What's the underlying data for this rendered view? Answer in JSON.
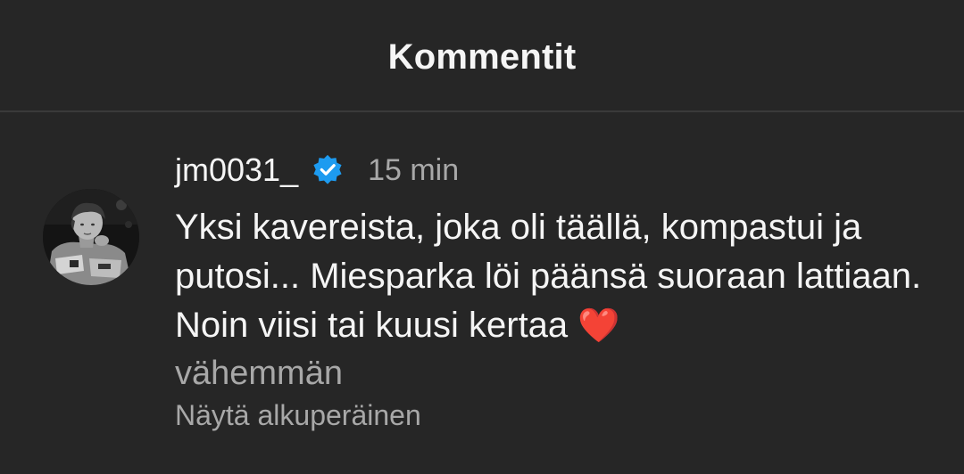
{
  "header": {
    "title": "Kommentit"
  },
  "comment": {
    "username": "jm0031_",
    "verified": true,
    "timestamp": "15 min",
    "text": "Yksi kavereista, joka oli täällä, kompastui ja putosi... Miesparka löi päänsä suoraan lattiaan. Noin viisi tai kuusi kertaa",
    "emoji": "❤️",
    "see_less": "vähemmän",
    "see_original": "Näytä alkuperäinen"
  },
  "colors": {
    "background": "#262626",
    "text_primary": "#f5f5f5",
    "text_secondary": "#a8a8a8",
    "verified_badge": "#1d9bf0",
    "heart": "#ef2e3b",
    "divider": "#3a3a3a"
  },
  "icons": {
    "verified": "verified-badge-icon",
    "avatar": "profile-photo"
  }
}
